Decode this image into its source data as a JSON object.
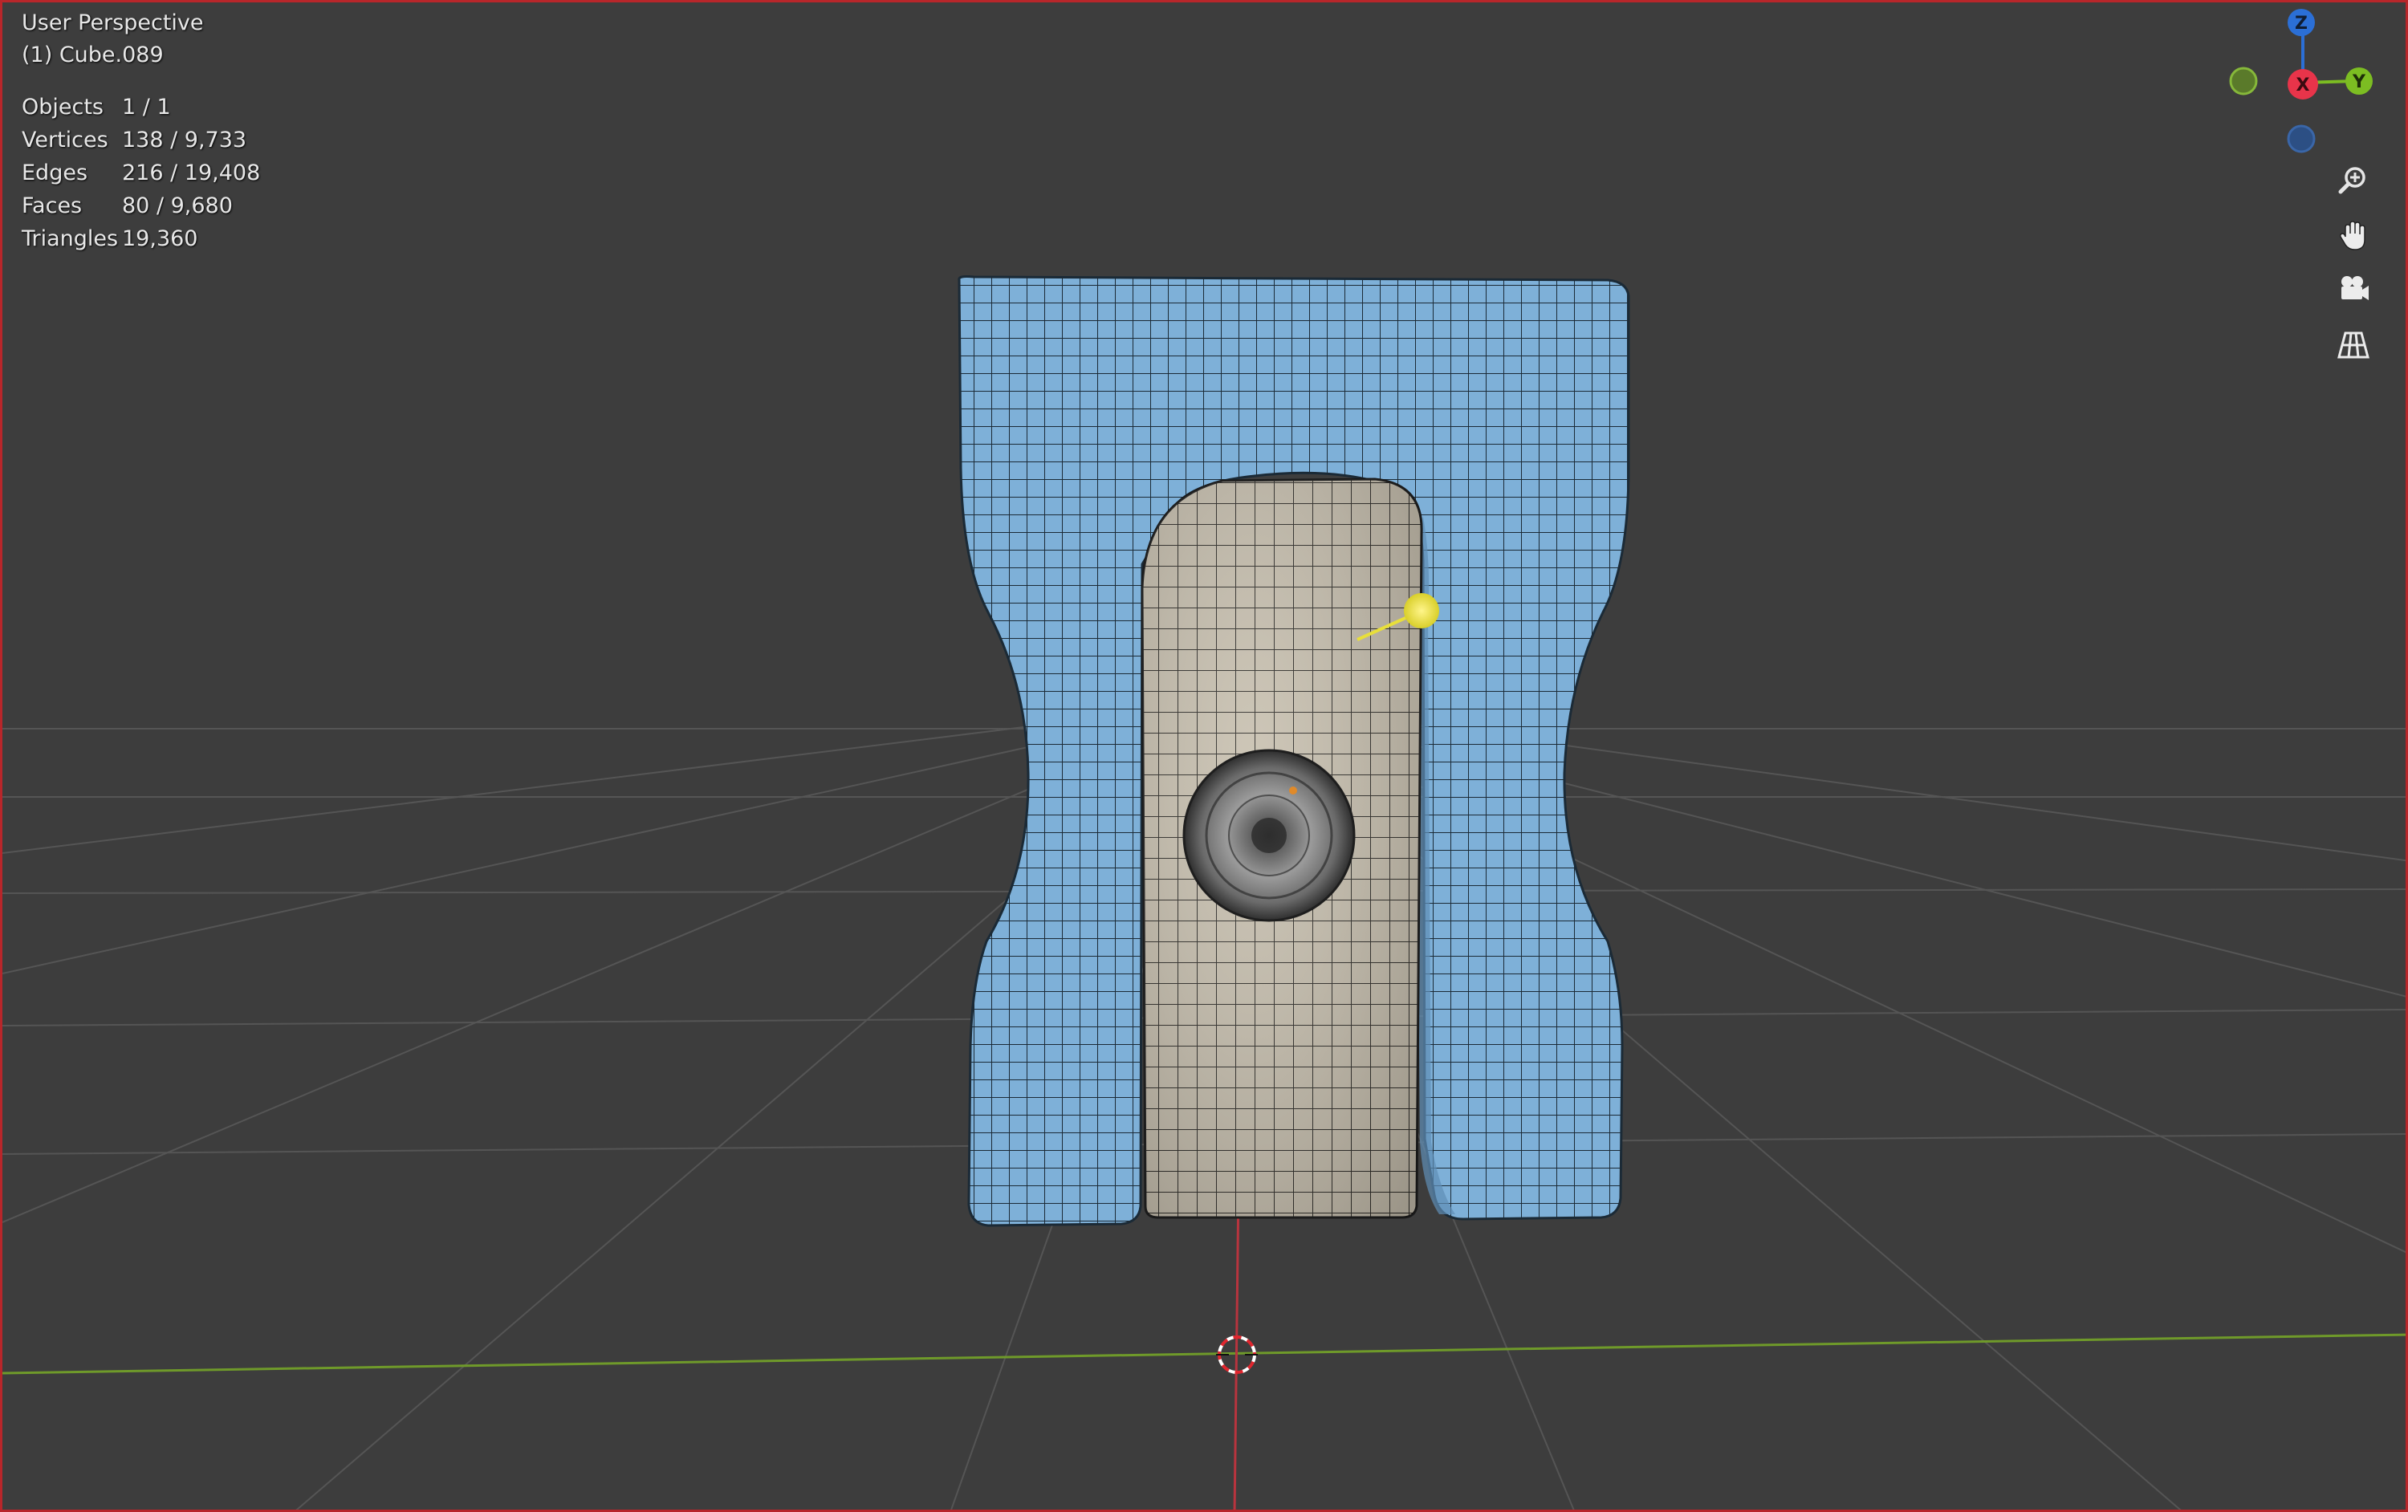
{
  "viewport": {
    "view_name": "User Perspective",
    "object_name": "(1) Cube.089"
  },
  "stats": [
    {
      "label": "Objects",
      "value": "1 / 1"
    },
    {
      "label": "Vertices",
      "value": "138 / 9,733"
    },
    {
      "label": "Edges",
      "value": "216 / 19,408"
    },
    {
      "label": "Faces",
      "value": "80 / 9,680"
    },
    {
      "label": "Triangles",
      "value": "19,360"
    }
  ],
  "gizmo": {
    "z_label": "Z",
    "x_label": "X",
    "y_label": "Y",
    "colors": {
      "x": "#e8344a",
      "y": "#7cbd22",
      "z": "#2b6fd6"
    }
  },
  "nav_tools": [
    {
      "name": "zoom-icon"
    },
    {
      "name": "pan-hand-icon"
    },
    {
      "name": "camera-icon"
    },
    {
      "name": "grid-perspective-icon"
    }
  ],
  "colors": {
    "background": "#3d3d3d",
    "border": "#b8262a",
    "mesh_blue": "#7eb0d8",
    "mesh_beige": "#c9c0ad",
    "light": "#f2e94a"
  }
}
